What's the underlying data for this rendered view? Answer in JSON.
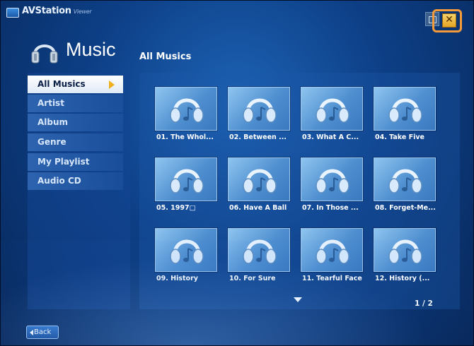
{
  "app": {
    "title": "AVStation",
    "subtitle": "Viewer"
  },
  "window_controls": {
    "close_glyph": "✕"
  },
  "header": {
    "heading": "Music",
    "section_title": "All Musics"
  },
  "sidebar": {
    "items": [
      {
        "label": "All Musics",
        "active": true
      },
      {
        "label": "Artist"
      },
      {
        "label": "Album"
      },
      {
        "label": "Genre"
      },
      {
        "label": "My Playlist"
      },
      {
        "label": "Audio CD"
      }
    ]
  },
  "tracks": [
    {
      "label": "01. The Whol..."
    },
    {
      "label": "02. Between ..."
    },
    {
      "label": "03. What A C..."
    },
    {
      "label": "04. Take Five"
    },
    {
      "label": "05. 1997□"
    },
    {
      "label": "06. Have A Ball"
    },
    {
      "label": "07. In Those ..."
    },
    {
      "label": "08. Forget-Me..."
    },
    {
      "label": "09. History"
    },
    {
      "label": "10. For Sure"
    },
    {
      "label": "11. Tearful Face"
    },
    {
      "label": "12. History (..."
    }
  ],
  "pagination": {
    "indicator": "1 / 2"
  },
  "footer": {
    "back_label": "Back"
  },
  "icons": {
    "app": "app-logo-icon",
    "restore": "restore-icon",
    "close": "close-icon",
    "header": "headphones-icon",
    "track": "headphones-note-icon",
    "next_page": "chevron-down-icon",
    "back": "triangle-left-icon",
    "nav_active": "triangle-right-icon"
  },
  "colors": {
    "background": "#0d3f86",
    "highlight": "#f39a3a",
    "close_button": "#e4a524",
    "active_arrow": "#f0b020"
  }
}
